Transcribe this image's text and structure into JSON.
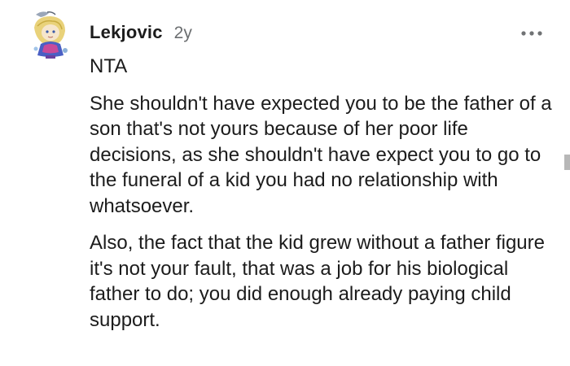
{
  "comment": {
    "username": "Lekjovic",
    "timestamp": "2y",
    "paragraphs": [
      "NTA",
      "She shouldn't have expected you to be the father of a son that's not yours because of her poor life decisions, as she shouldn't have expect you to go to the funeral of a kid you had no relationship with whatsoever.",
      "Also, the fact that the kid grew without a father figure it's not your fault, that was a job for his biological father to do; you did enough already paying child support."
    ],
    "more_icon": "more-options-icon",
    "avatar_icon": "user-avatar"
  }
}
